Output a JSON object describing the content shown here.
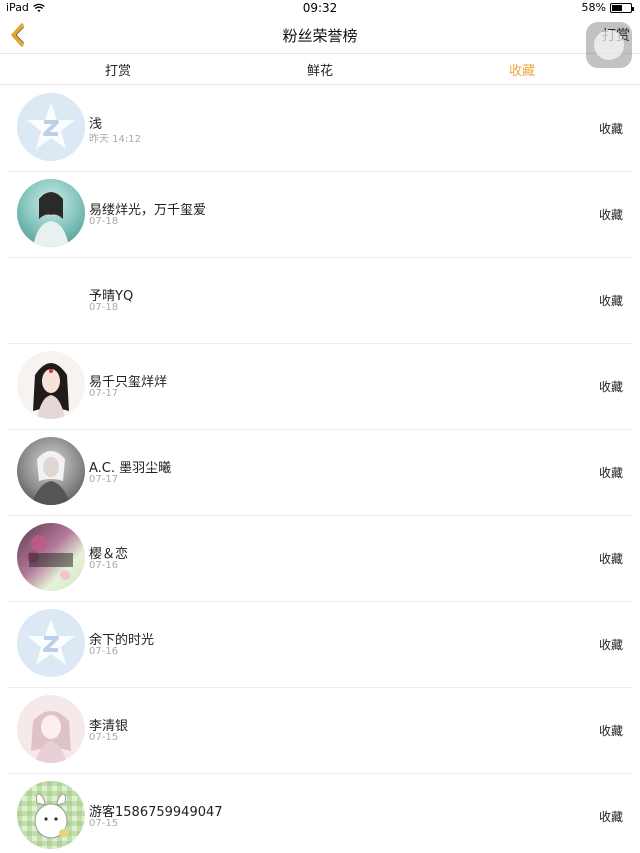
{
  "statusbar": {
    "device": "iPad",
    "time": "09:32",
    "battery": "58%",
    "battery_level": 0.58
  },
  "nav": {
    "title": "粉丝荣誉榜",
    "right_action": "打赏"
  },
  "tabs": [
    {
      "label": "打赏",
      "active": false
    },
    {
      "label": "鲜花",
      "active": false
    },
    {
      "label": "收藏",
      "active": true
    }
  ],
  "colors": {
    "accent": "#f0a63c",
    "divider": "#ececec",
    "subtext": "#aaaaaa"
  },
  "list": [
    {
      "name": "浅",
      "time": "昨天 14:12",
      "action": "收藏",
      "avatar": "default-qq-avatar"
    },
    {
      "name": "易缕烊光，万千玺爱",
      "time": "07-18",
      "action": "收藏",
      "avatar": "user-photo"
    },
    {
      "name": "予晴YQ",
      "time": "07-18",
      "action": "收藏",
      "avatar": "blank"
    },
    {
      "name": "易千只玺烊烊",
      "time": "07-17",
      "action": "收藏",
      "avatar": "user-photo"
    },
    {
      "name": "A.C. 墨羽尘曦",
      "time": "07-17",
      "action": "收藏",
      "avatar": "user-photo"
    },
    {
      "name": "樱＆恋",
      "time": "07-16",
      "action": "收藏",
      "avatar": "user-photo"
    },
    {
      "name": "余下的时光",
      "time": "07-16",
      "action": "收藏",
      "avatar": "default-qq-avatar"
    },
    {
      "name": "李清银",
      "time": "07-15",
      "action": "收藏",
      "avatar": "user-photo"
    },
    {
      "name": "游客1586759949047",
      "time": "07-15",
      "action": "收藏",
      "avatar": "user-photo"
    }
  ]
}
